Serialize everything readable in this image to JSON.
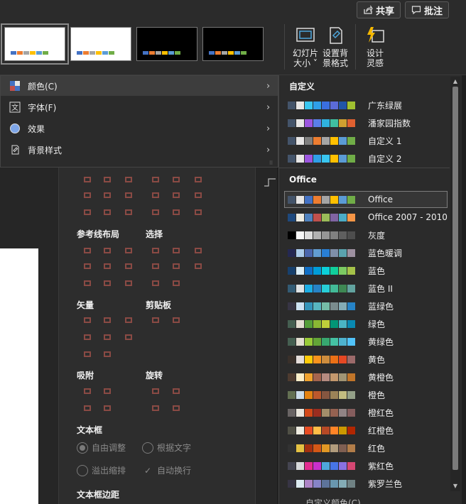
{
  "topbar": {
    "share_label": "共享",
    "comment_label": "批注"
  },
  "ribbon": {
    "slide_size_label_1": "幻灯片",
    "slide_size_label_2": "大小 ˅",
    "format_bg_label_1": "设置背",
    "format_bg_label_2": "景格式",
    "design_label_1": "设计",
    "design_label_2": "灵感",
    "thumb_bar_colors": [
      "#4472c4",
      "#ed7d31",
      "#a5a5a5",
      "#ffc000",
      "#5b9bd5",
      "#70ad47"
    ]
  },
  "menu": {
    "items": [
      {
        "label": "颜色(C)",
        "icon": "color-palette-icon"
      },
      {
        "label": "字体(F)",
        "icon": "font-icon"
      },
      {
        "label": "效果",
        "icon": "effects-icon"
      },
      {
        "label": "背景样式",
        "icon": "background-style-icon"
      }
    ]
  },
  "panel": {
    "sections": {
      "guides": "参考线布局",
      "select": "选择",
      "vector": "矢量",
      "clipboard": "剪贴板",
      "snap": "吸附",
      "rotate": "旋转",
      "textbox": "文本框",
      "textbox_margin": "文本框边距"
    },
    "options": {
      "free_adjust": "自由调整",
      "fit_text": "根据文字",
      "overflow_shrink": "溢出缩排",
      "auto_wrap": "自动换行"
    }
  },
  "submenu": {
    "custom_heading": "自定义",
    "office_heading": "Office",
    "footer_label": "自定义颜色(C)...",
    "custom_schemes": [
      {
        "name": "广东绿展",
        "colors": [
          "#44546a",
          "#e7e6e6",
          "#39c6f0",
          "#2f9fe8",
          "#3a6fe0",
          "#5b6bd8",
          "#2155a8",
          "#a0c030"
        ]
      },
      {
        "name": "潘家园指数",
        "colors": [
          "#44546a",
          "#e7e6e6",
          "#9c56e0",
          "#5a7fe8",
          "#2fb2e0",
          "#40c0a0",
          "#d0a030",
          "#e06030"
        ]
      },
      {
        "name": "自定义 1",
        "colors": [
          "#44546a",
          "#e7e6e6",
          "#7f7f7f",
          "#ed7d31",
          "#a5a5a5",
          "#ffc000",
          "#5b9bd5",
          "#70ad47"
        ]
      },
      {
        "name": "自定义 2",
        "colors": [
          "#44546a",
          "#e7e6e6",
          "#9c56e0",
          "#2f9fe8",
          "#39c6f0",
          "#ffc000",
          "#5b9bd5",
          "#70ad47"
        ]
      }
    ],
    "office_schemes": [
      {
        "name": "Office",
        "colors": [
          "#44546a",
          "#e7e6e6",
          "#4472c4",
          "#ed7d31",
          "#a5a5a5",
          "#ffc000",
          "#5b9bd5",
          "#70ad47"
        ]
      },
      {
        "name": "Office 2007 - 2010",
        "colors": [
          "#1f497d",
          "#eeece1",
          "#4f81bd",
          "#c0504d",
          "#9bbb59",
          "#8064a2",
          "#4bacc6",
          "#f79646"
        ]
      },
      {
        "name": "灰度",
        "colors": [
          "#000000",
          "#f8f8f8",
          "#dddddd",
          "#b2b2b2",
          "#969696",
          "#808080",
          "#5f5f5f",
          "#4d4d4d"
        ]
      },
      {
        "name": "蓝色暖调",
        "colors": [
          "#242852",
          "#acccea",
          "#4a66ac",
          "#629dd1",
          "#297fd5",
          "#7f8fa9",
          "#5aa2ae",
          "#9d90a0"
        ]
      },
      {
        "name": "蓝色",
        "colors": [
          "#17406d",
          "#dbeff9",
          "#0f6fc6",
          "#009dd9",
          "#0bd0d9",
          "#10cf9b",
          "#7cca62",
          "#a5c249"
        ]
      },
      {
        "name": "蓝色 II",
        "colors": [
          "#335b74",
          "#dfe3e5",
          "#1cade4",
          "#2683c6",
          "#27ced7",
          "#42ba97",
          "#3e8853",
          "#62a39f"
        ]
      },
      {
        "name": "蓝绿色",
        "colors": [
          "#373545",
          "#cee3f5",
          "#3494ba",
          "#58b6c0",
          "#75bda7",
          "#7a8c8e",
          "#84acb6",
          "#2683c6"
        ]
      },
      {
        "name": "绿色",
        "colors": [
          "#455f51",
          "#e3ded1",
          "#549e39",
          "#8ab833",
          "#c0cf3a",
          "#029676",
          "#4ab5c4",
          "#0989b1"
        ]
      },
      {
        "name": "黄绿色",
        "colors": [
          "#455f51",
          "#e3ded1",
          "#99cb38",
          "#63a537",
          "#37a76f",
          "#44c1a3",
          "#4eb3cf",
          "#51c3f9"
        ]
      },
      {
        "name": "黄色",
        "colors": [
          "#39302a",
          "#e5dedb",
          "#ffca08",
          "#f8931d",
          "#ce8d3e",
          "#ec7016",
          "#e64823",
          "#9c6a6a"
        ]
      },
      {
        "name": "黄橙色",
        "colors": [
          "#4e3b30",
          "#fbeec9",
          "#f0a22e",
          "#a5644e",
          "#b58b80",
          "#c3986d",
          "#a19574",
          "#c17529"
        ]
      },
      {
        "name": "橙色",
        "colors": [
          "#637052",
          "#ccddea",
          "#e48312",
          "#bd582c",
          "#865640",
          "#9b8357",
          "#c2bc80",
          "#94a088"
        ]
      },
      {
        "name": "橙红色",
        "colors": [
          "#696464",
          "#e9e5dc",
          "#d34817",
          "#9b2d1f",
          "#a28e6a",
          "#956251",
          "#918485",
          "#855d5d"
        ]
      },
      {
        "name": "红橙色",
        "colors": [
          "#505046",
          "#eeece1",
          "#e84c22",
          "#ffbd47",
          "#b64926",
          "#ff8427",
          "#cc9900",
          "#b22600"
        ]
      },
      {
        "name": "红色",
        "colors": [
          "#323232",
          "#e5c243",
          "#a5300f",
          "#d55816",
          "#e19825",
          "#b19c7d",
          "#7f5f52",
          "#b27d49"
        ]
      },
      {
        "name": "紫红色",
        "colors": [
          "#454551",
          "#d8d9dc",
          "#e32d91",
          "#c830cc",
          "#4ea6dc",
          "#4775e7",
          "#8971e1",
          "#d54773"
        ]
      },
      {
        "name": "紫罗兰色",
        "colors": [
          "#373545",
          "#dceaf3",
          "#ad84c6",
          "#8784c7",
          "#5d739a",
          "#6997af",
          "#84acb6",
          "#6f8183"
        ]
      }
    ]
  }
}
